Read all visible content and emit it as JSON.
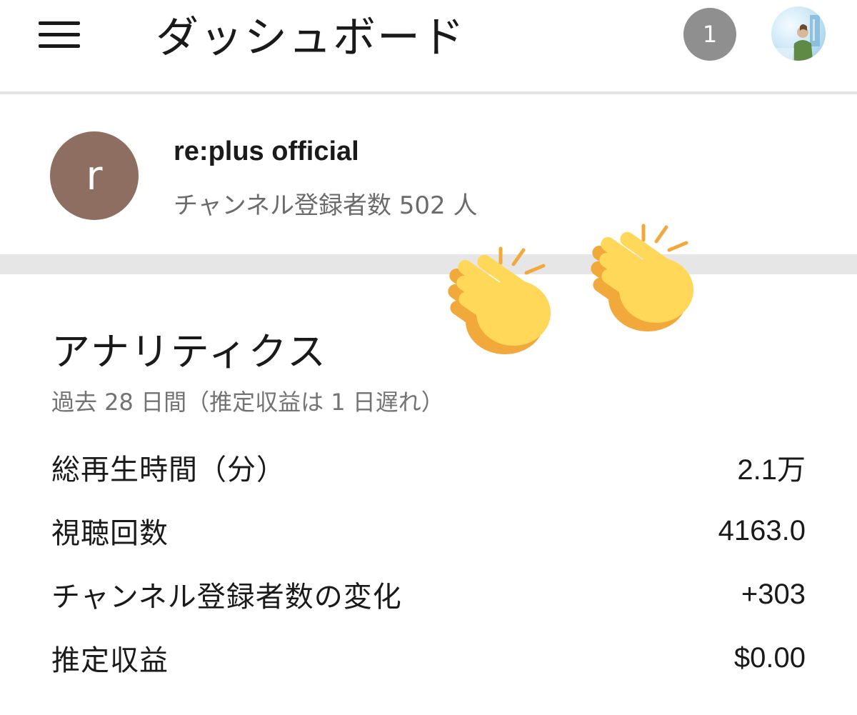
{
  "header": {
    "title": "ダッシュボード",
    "notification_count": "1",
    "menu_icon": "hamburger-menu-icon"
  },
  "channel": {
    "avatar_letter": "r",
    "avatar_color": "#8e6e61",
    "name": "re:plus official",
    "subscribers": "チャンネル登録者数 502 人"
  },
  "analytics": {
    "title": "アナリティクス",
    "subtitle": "過去 28 日間（推定収益は 1 日遅れ）",
    "metrics": [
      {
        "label": "総再生時間（分）",
        "value": "2.1万"
      },
      {
        "label": "視聴回数",
        "value": "4163.0"
      },
      {
        "label": "チャンネル登録者数の変化",
        "value": "+303"
      },
      {
        "label": "推定収益",
        "value": "$0.00"
      }
    ]
  },
  "stickers": [
    "clapping-hands-icon",
    "clapping-hands-icon"
  ],
  "colors": {
    "badge": "#8f8f8f",
    "divider": "#e6e6e6",
    "clap_yellow": "#ffd85a",
    "clap_orange": "#f2a93b"
  }
}
